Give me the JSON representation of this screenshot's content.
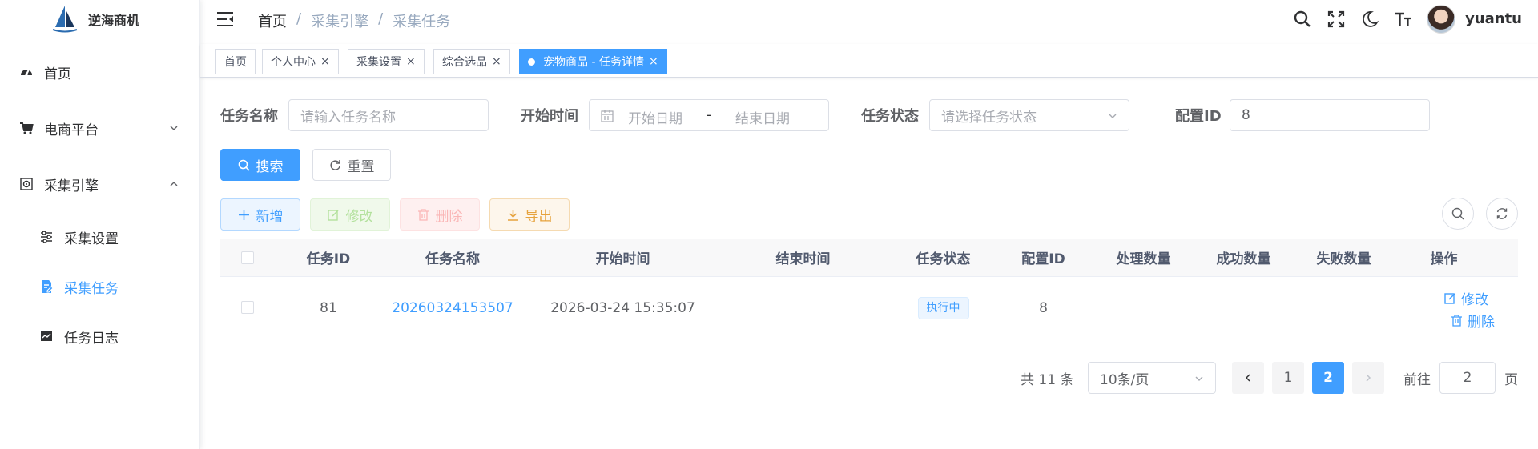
{
  "app": {
    "title": "逆海商机"
  },
  "sidebar": {
    "items": [
      {
        "label": "首页"
      },
      {
        "label": "电商平台"
      },
      {
        "label": "采集引擎"
      },
      {
        "label": "采集设置"
      },
      {
        "label": "采集任务"
      },
      {
        "label": "任务日志"
      }
    ]
  },
  "header": {
    "breadcrumb": [
      "首页",
      "采集引擎",
      "采集任务"
    ],
    "breadcrumb_sep": "/",
    "username": "yuantu"
  },
  "tags": [
    {
      "label": "首页"
    },
    {
      "label": "个人中心"
    },
    {
      "label": "采集设置"
    },
    {
      "label": "综合选品"
    },
    {
      "label": "宠物商品 - 任务详情"
    }
  ],
  "tag_close": "×",
  "form": {
    "task_name_label": "任务名称",
    "task_name_placeholder": "请输入任务名称",
    "start_time_label": "开始时间",
    "start_date_placeholder": "开始日期",
    "range_sep": "-",
    "end_date_placeholder": "结束日期",
    "status_label": "任务状态",
    "status_placeholder": "请选择任务状态",
    "config_id_label": "配置ID",
    "config_id_value": "8",
    "search_button": "搜索",
    "reset_button": "重置"
  },
  "toolbar": {
    "add": "新增",
    "edit": "修改",
    "delete": "删除",
    "export": "导出"
  },
  "table": {
    "columns": [
      "任务ID",
      "任务名称",
      "开始时间",
      "结束时间",
      "任务状态",
      "配置ID",
      "处理数量",
      "成功数量",
      "失败数量",
      "操作"
    ],
    "rows": [
      {
        "id": "81",
        "name": "20260324153507",
        "start_time": "2026-03-24 15:35:07",
        "end_time": "",
        "status": "执行中",
        "config_id": "8",
        "processed": "",
        "success": "",
        "failed": "",
        "op_edit": "修改",
        "op_delete": "删除"
      }
    ]
  },
  "pagination": {
    "total_text": "共 11 条",
    "page_size": "10条/页",
    "pages": [
      "1",
      "2"
    ],
    "current": "2",
    "goto_label": "前往",
    "goto_value": "2",
    "goto_unit": "页"
  },
  "colors": {
    "primary": "#409eff",
    "warning": "#e6a23c"
  }
}
